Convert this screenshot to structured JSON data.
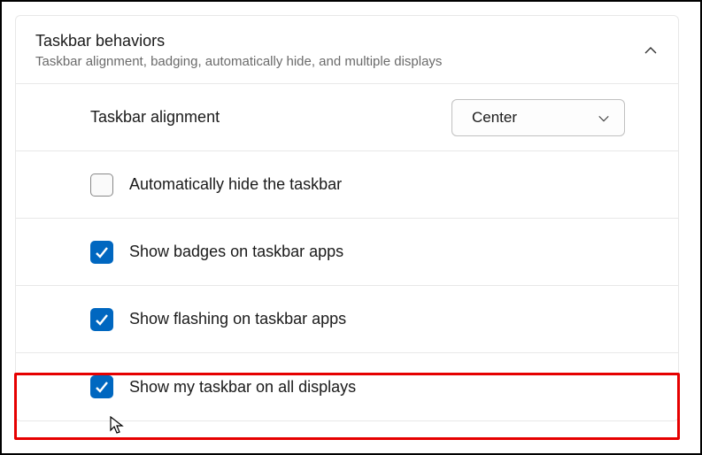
{
  "header": {
    "title": "Taskbar behaviors",
    "subtitle": "Taskbar alignment, badging, automatically hide, and multiple displays"
  },
  "alignment": {
    "label": "Taskbar alignment",
    "selected": "Center"
  },
  "options": [
    {
      "label": "Automatically hide the taskbar",
      "checked": false
    },
    {
      "label": "Show badges on taskbar apps",
      "checked": true
    },
    {
      "label": "Show flashing on taskbar apps",
      "checked": true
    },
    {
      "label": "Show my taskbar on all displays",
      "checked": true
    }
  ]
}
